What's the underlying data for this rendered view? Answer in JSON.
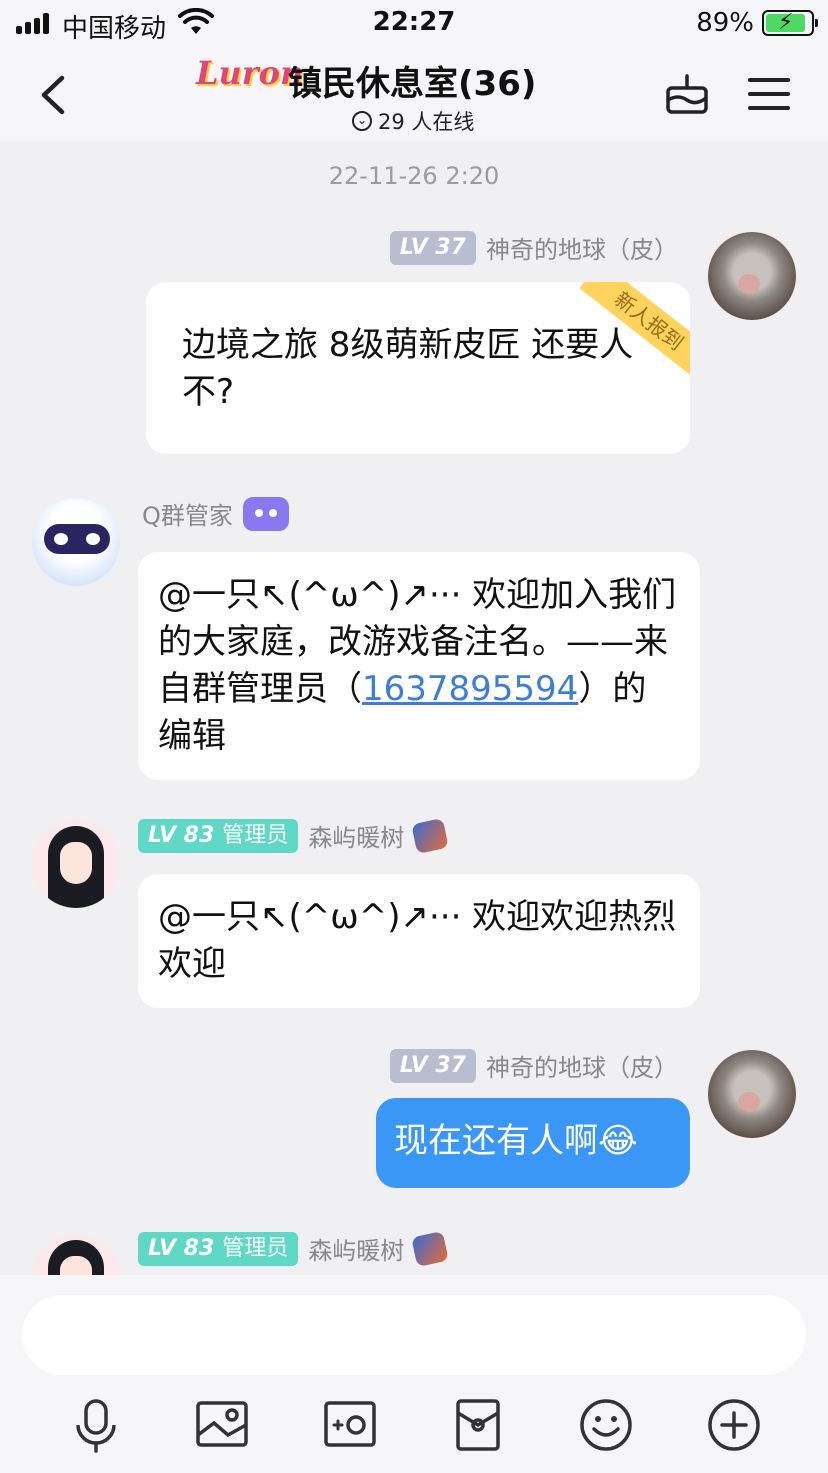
{
  "status_bar": {
    "carrier": "中国移动",
    "time": "22:27",
    "battery_percent": "89%",
    "battery_fill": 0.89
  },
  "header": {
    "logo_text": "Luron",
    "title": "镇民休息室(36)",
    "online_text": "29 人在线"
  },
  "chat": {
    "timestamp": "22-11-26 2:20",
    "messages": [
      {
        "sender": "神奇的地球（皮）",
        "level": "LV 37",
        "text": "边境之旅 8级萌新皮匠 还要人不?",
        "ribbon": "新人报到"
      },
      {
        "sender": "Q群管家",
        "text_before": "@一只↖(^ω^)↗··· 欢迎加入我们的大家庭，改游戏备注名。——来自群管理员（",
        "link": "1637895594",
        "text_after": "）的编辑"
      },
      {
        "sender": "森屿暖树",
        "level": "LV 83",
        "role": "管理员",
        "text": "@一只↖(^ω^)↗··· 欢迎欢迎热烈欢迎"
      },
      {
        "sender": "神奇的地球（皮）",
        "level": "LV 37",
        "text": "现在还有人啊😂"
      },
      {
        "sender": "森屿暖树",
        "level": "LV 83",
        "role": "管理员"
      }
    ]
  },
  "icons": {
    "toolbar": [
      "microphone-icon",
      "image-icon",
      "camera-icon",
      "red-packet-icon",
      "emoji-icon",
      "plus-icon"
    ]
  },
  "colors": {
    "accent": "#3b97f5",
    "admin_badge": "#5fd8c5",
    "level_badge": "#b9bdcf",
    "link": "#3b7dd8",
    "ribbon": "#ffd35c"
  }
}
